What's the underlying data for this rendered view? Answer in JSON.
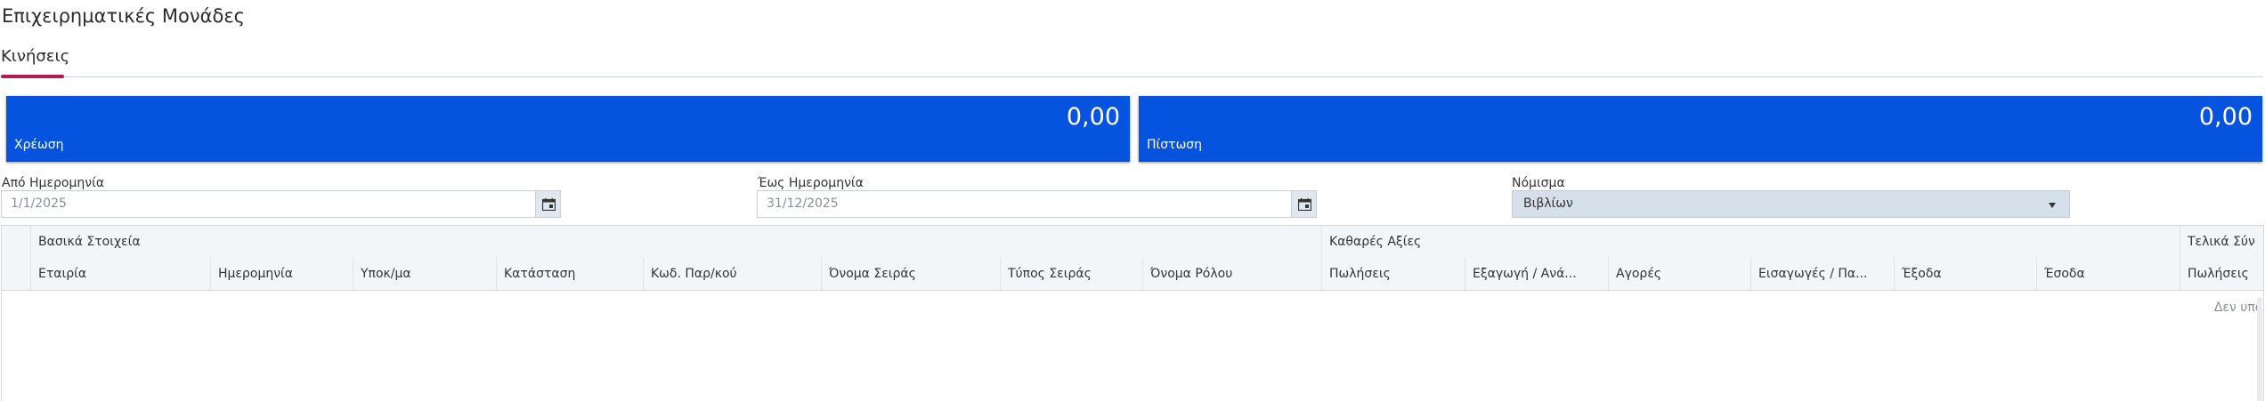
{
  "page": {
    "title": "Επιχειρηματικές Μονάδες"
  },
  "tabs": [
    {
      "label": "Κινήσεις",
      "active": true
    }
  ],
  "tiles": {
    "debit": {
      "label": "Χρέωση",
      "amount": "0,00"
    },
    "credit": {
      "label": "Πίστωση",
      "amount": "0,00"
    },
    "color": "#0553de"
  },
  "filters": {
    "from_date": {
      "label": "Από Ημερομηνία",
      "value": "1/1/2025"
    },
    "to_date": {
      "label": "Έως Ημερομηνία",
      "value": "31/12/2025"
    },
    "currency": {
      "label": "Νόμισμα",
      "value": "Βιβλίων"
    }
  },
  "grid": {
    "groups": [
      "Βασικά Στοιχεία",
      "Καθαρές Αξίες",
      "Τελικά Σύν"
    ],
    "columns": [
      "Εταιρία",
      "Ημερομηνία",
      "Υποκ/μα",
      "Κατάσταση",
      "Κωδ. Παρ/κού",
      "Όνομα Σειράς",
      "Τύπος Σειράς",
      "Όνομα Ρόλου",
      "Πωλήσεις",
      "Εξαγωγή / Ανά...",
      "Αγορές",
      "Εισαγωγές / Πα...",
      "Έξοδα",
      "Έσοδα",
      "Πωλήσεις"
    ],
    "empty_text": "Δεν υπά",
    "rows": []
  },
  "colors": {
    "accent": "#b51a4e",
    "tile": "#0553de",
    "header_bg": "#f3f6f9"
  }
}
